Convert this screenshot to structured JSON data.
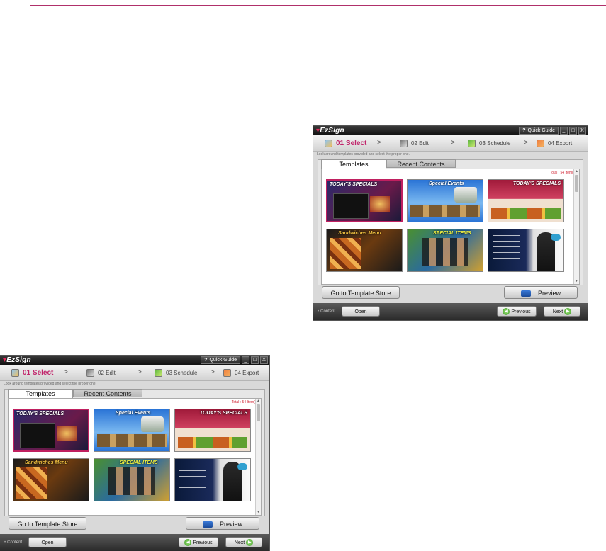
{
  "app": {
    "logo_text": "EzSign",
    "quick_guide": "Quick Guide",
    "window_controls": [
      "_",
      "□",
      "X"
    ]
  },
  "steps": [
    {
      "label": "01 Select",
      "icon": "select-step-icon",
      "active": true
    },
    {
      "label": "02 Edit",
      "icon": "edit-step-icon",
      "active": false
    },
    {
      "label": "03 Schedule",
      "icon": "schedule-step-icon",
      "active": false
    },
    {
      "label": "04 Export",
      "icon": "export-step-icon",
      "active": false
    }
  ],
  "step_separator": ">",
  "hint": "Look around templates provided and select the proper one.",
  "tabs": {
    "templates": "Templates",
    "recent": "Recent Contents"
  },
  "total": "Total : 54 Item(s)",
  "templates": [
    {
      "title": "TODAY'S SPECIALS"
    },
    {
      "title": "Special Events"
    },
    {
      "title": "TODAY'S SPECIALS"
    },
    {
      "title": "Sandwiches Menu"
    },
    {
      "title": "SPECIAL ITEMS"
    },
    {
      "title": ""
    }
  ],
  "buttons": {
    "template_store": "Go to Template Store",
    "preview": "Preview",
    "content_label": "Content",
    "open": "Open",
    "previous": "Previous",
    "next": "Next"
  },
  "colors": {
    "accent": "#c0246a",
    "total_text": "#d02030",
    "titlebar": "#1a1a1a"
  }
}
